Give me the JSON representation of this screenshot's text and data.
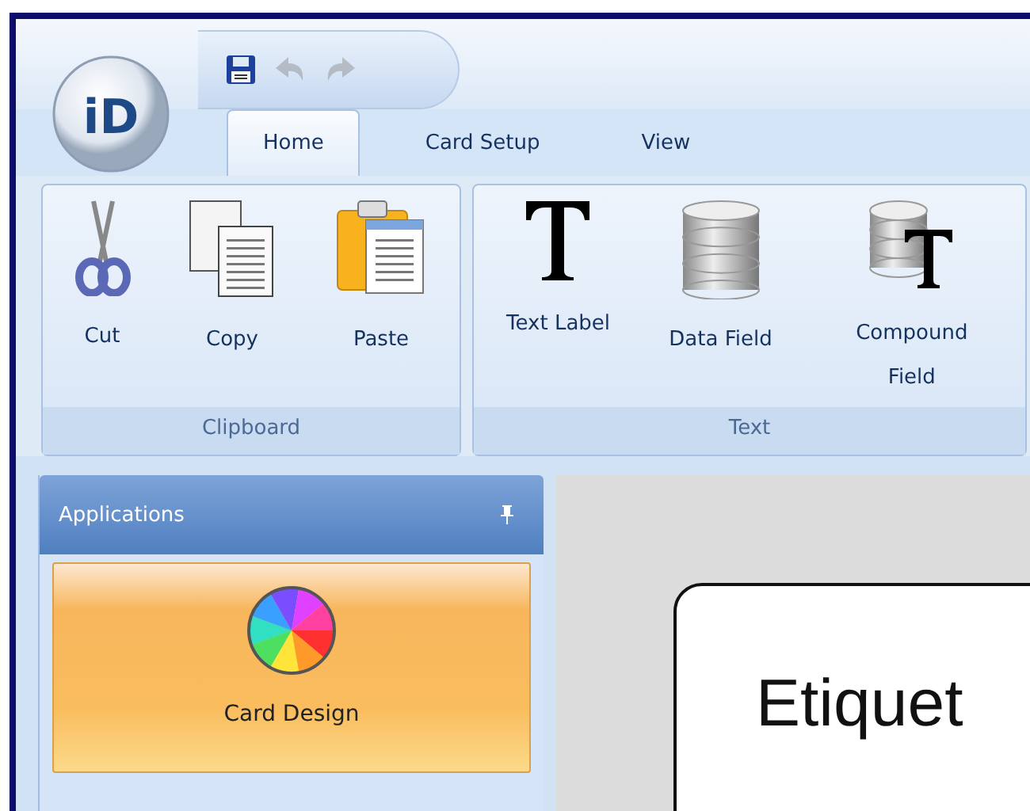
{
  "logo": {
    "text": "iD"
  },
  "quick_access": [
    {
      "kind": "save",
      "disabled": false
    },
    {
      "kind": "undo",
      "disabled": true
    },
    {
      "kind": "redo",
      "disabled": true
    }
  ],
  "tabs": [
    {
      "label": "Home",
      "selected": true
    },
    {
      "label": "Card Setup",
      "selected": false
    },
    {
      "label": "View",
      "selected": false
    }
  ],
  "ribbon_groups": [
    {
      "label": "Clipboard",
      "buttons": [
        {
          "kind": "cut",
          "label": "Cut"
        },
        {
          "kind": "copy",
          "label": "Copy"
        },
        {
          "kind": "paste",
          "label": "Paste"
        }
      ]
    },
    {
      "label": "Text",
      "buttons": [
        {
          "kind": "text",
          "label": "Text Label"
        },
        {
          "kind": "data",
          "label": "Data Field"
        },
        {
          "kind": "compound",
          "label": "Compound Field"
        }
      ]
    }
  ],
  "applications_panel": {
    "title": "Applications",
    "items": [
      {
        "label": "Card Design",
        "selected": true
      }
    ]
  },
  "canvas": {
    "card_text": "Etiquet"
  }
}
